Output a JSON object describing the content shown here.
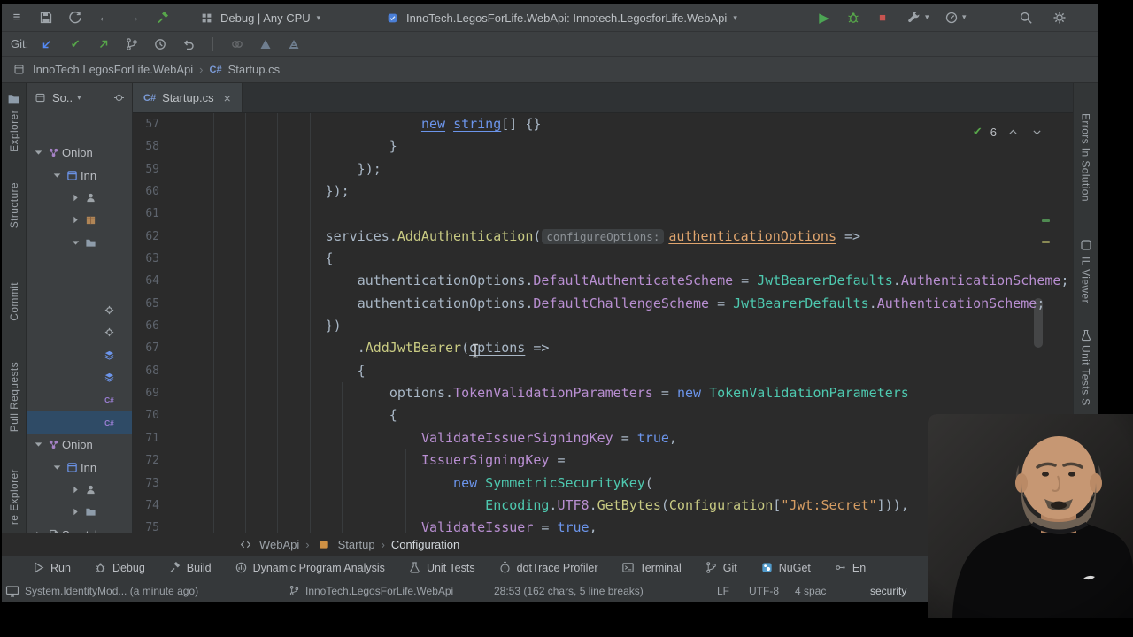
{
  "icons": {
    "menu": "≡",
    "caret_down": "▾",
    "back": "←",
    "forward": "→",
    "play": "▶",
    "stop": "■",
    "check": "✔",
    "crumb_sep": "›",
    "close": "×"
  },
  "chrome": {
    "toolbar": {
      "solution_combo": "Debug | Any CPU",
      "run_combo": "InnoTech.LegosForLife.WebApi: Innotech.LegosforLife.WebApi"
    },
    "git_label": "Git:",
    "breadcrumb": {
      "project": "InnoTech.LegosForLife.WebApi",
      "file_badge": "C#",
      "file": "Startup.cs"
    }
  },
  "left_stripe": {
    "items": [
      "Explorer",
      "Structure",
      "Commit",
      "Pull Requests",
      "re Explorer"
    ]
  },
  "right_stripe": {
    "items": [
      "Errors In Solution",
      "IL Viewer",
      "Unit Tests S"
    ]
  },
  "project_panel": {
    "scope_label": "So..",
    "tree": [
      {
        "indent": 0,
        "chev": "down",
        "icon": "solution",
        "label": "Onion"
      },
      {
        "indent": 1,
        "chev": "down",
        "icon": "project",
        "label": "Inn"
      },
      {
        "indent": 2,
        "chev": "right",
        "icon": "person",
        "label": ""
      },
      {
        "indent": 2,
        "chev": "right",
        "icon": "package",
        "label": ""
      },
      {
        "indent": 2,
        "chev": "down",
        "icon": "folder",
        "label": ""
      },
      {
        "gap": true
      },
      {
        "gap": true
      },
      {
        "indent": 3,
        "icon": "gearfile",
        "label": ""
      },
      {
        "indent": 3,
        "icon": "gearfile",
        "label": ""
      },
      {
        "indent": 3,
        "icon": "layers",
        "label": ""
      },
      {
        "indent": 3,
        "icon": "layers",
        "label": ""
      },
      {
        "indent": 3,
        "icon": "csfile",
        "label": ""
      },
      {
        "indent": 3,
        "icon": "csfile",
        "label": "",
        "selected": true
      },
      {
        "indent": 0,
        "chev": "down",
        "icon": "solution",
        "label": "Onion"
      },
      {
        "indent": 1,
        "chev": "down",
        "icon": "project",
        "label": "Inn"
      },
      {
        "indent": 2,
        "chev": "right",
        "icon": "person",
        "label": ""
      },
      {
        "indent": 2,
        "chev": "right",
        "icon": "folder",
        "label": ""
      },
      {
        "indent": 0,
        "chev": "right",
        "icon": "scratch",
        "label": "Scratches"
      }
    ]
  },
  "editor": {
    "tab": {
      "badge": "C#",
      "label": "Startup.cs"
    },
    "inspections": {
      "count": "6"
    },
    "lines": [
      {
        "n": "57",
        "t": [
          [
            "                              ",
            ""
          ],
          [
            "new",
            "ku"
          ],
          [
            " ",
            ""
          ],
          [
            "string",
            "ku"
          ],
          [
            "[] {}",
            ""
          ]
        ]
      },
      {
        "n": "58",
        "t": [
          [
            "                          }",
            ""
          ]
        ]
      },
      {
        "n": "59",
        "t": [
          [
            "                      });",
            ""
          ]
        ]
      },
      {
        "n": "60",
        "t": [
          [
            "                  });",
            ""
          ]
        ]
      },
      {
        "n": "61",
        "t": [
          [
            "",
            ""
          ]
        ]
      },
      {
        "n": "62",
        "t": [
          [
            "                  ",
            ""
          ],
          [
            "services",
            ""
          ],
          [
            ".",
            ""
          ],
          [
            "AddAuthentication",
            "m"
          ],
          [
            "(",
            ""
          ],
          [
            "configureOptions:",
            "h"
          ],
          [
            "authenticationOptions",
            "pm"
          ],
          [
            " =>",
            ""
          ]
        ]
      },
      {
        "n": "63",
        "t": [
          [
            "                  {",
            ""
          ]
        ]
      },
      {
        "n": "64",
        "t": [
          [
            "                      ",
            ""
          ],
          [
            "authenticationOptions",
            ""
          ],
          [
            ".",
            ""
          ],
          [
            "DefaultAuthenticateScheme",
            "p"
          ],
          [
            " = ",
            ""
          ],
          [
            "JwtBearerDefaults",
            "t"
          ],
          [
            ".",
            ""
          ],
          [
            "AuthenticationScheme",
            "p"
          ],
          [
            ";",
            ""
          ]
        ]
      },
      {
        "n": "65",
        "t": [
          [
            "                      ",
            ""
          ],
          [
            "authenticationOptions",
            ""
          ],
          [
            ".",
            ""
          ],
          [
            "DefaultChallengeScheme",
            "p"
          ],
          [
            " = ",
            ""
          ],
          [
            "JwtBearerDefaults",
            "t"
          ],
          [
            ".",
            ""
          ],
          [
            "AuthenticationScheme",
            "p"
          ],
          [
            ";",
            ""
          ]
        ]
      },
      {
        "n": "66",
        "t": [
          [
            "                  })",
            ""
          ]
        ]
      },
      {
        "n": "67",
        "t": [
          [
            "                      ",
            ""
          ],
          [
            ".",
            ""
          ],
          [
            "AddJwtBearer",
            "m"
          ],
          [
            "(",
            ""
          ],
          [
            "options",
            "iu"
          ],
          [
            " =>",
            ""
          ]
        ]
      },
      {
        "n": "68",
        "t": [
          [
            "                      {",
            ""
          ]
        ]
      },
      {
        "n": "69",
        "t": [
          [
            "                          ",
            ""
          ],
          [
            "options",
            ""
          ],
          [
            ".",
            ""
          ],
          [
            "TokenValidationParameters",
            "p"
          ],
          [
            " = ",
            ""
          ],
          [
            "new",
            "k"
          ],
          [
            " ",
            ""
          ],
          [
            "TokenValidationParameters",
            "t"
          ]
        ]
      },
      {
        "n": "70",
        "t": [
          [
            "                          {",
            ""
          ]
        ]
      },
      {
        "n": "71",
        "t": [
          [
            "                              ",
            ""
          ],
          [
            "ValidateIssuerSigningKey",
            "p"
          ],
          [
            " = ",
            ""
          ],
          [
            "true",
            "k"
          ],
          [
            ",",
            ""
          ]
        ]
      },
      {
        "n": "72",
        "t": [
          [
            "                              ",
            ""
          ],
          [
            "IssuerSigningKey",
            "p"
          ],
          [
            " =",
            ""
          ]
        ]
      },
      {
        "n": "73",
        "t": [
          [
            "                                  ",
            ""
          ],
          [
            "new",
            "k"
          ],
          [
            " ",
            ""
          ],
          [
            "SymmetricSecurityKey",
            "t"
          ],
          [
            "(",
            ""
          ]
        ]
      },
      {
        "n": "74",
        "t": [
          [
            "                                      ",
            ""
          ],
          [
            "Encoding",
            "t"
          ],
          [
            ".",
            ""
          ],
          [
            "UTF8",
            "p"
          ],
          [
            ".",
            ""
          ],
          [
            "GetBytes",
            "m"
          ],
          [
            "(",
            ""
          ],
          [
            "Configuration",
            "m"
          ],
          [
            "[",
            ""
          ],
          [
            "\"Jwt:Secret\"",
            "s"
          ],
          [
            "])),",
            ""
          ]
        ]
      },
      {
        "n": "75",
        "t": [
          [
            "                              ",
            ""
          ],
          [
            "ValidateIssuer",
            "p"
          ],
          [
            " = ",
            ""
          ],
          [
            "true",
            "k"
          ],
          [
            ",",
            ""
          ]
        ]
      }
    ]
  },
  "code_breadcrumbs": {
    "items": [
      "WebApi",
      "Startup",
      "Configuration"
    ]
  },
  "tool_buttons": {
    "items": [
      "Run",
      "Debug",
      "Build",
      "Dynamic Program Analysis",
      "Unit Tests",
      "dotTrace Profiler",
      "Terminal",
      "Git",
      "NuGet",
      "En"
    ]
  },
  "status_bar": {
    "vcs_message": "System.IdentityMod... (a minute ago)",
    "branch": "InnoTech.LegosForLife.WebApi",
    "caret": "28:53 (162 chars, 5 line breaks)",
    "line_sep": "LF",
    "encoding": "UTF-8",
    "indent": "4 spac",
    "extra": "security"
  }
}
